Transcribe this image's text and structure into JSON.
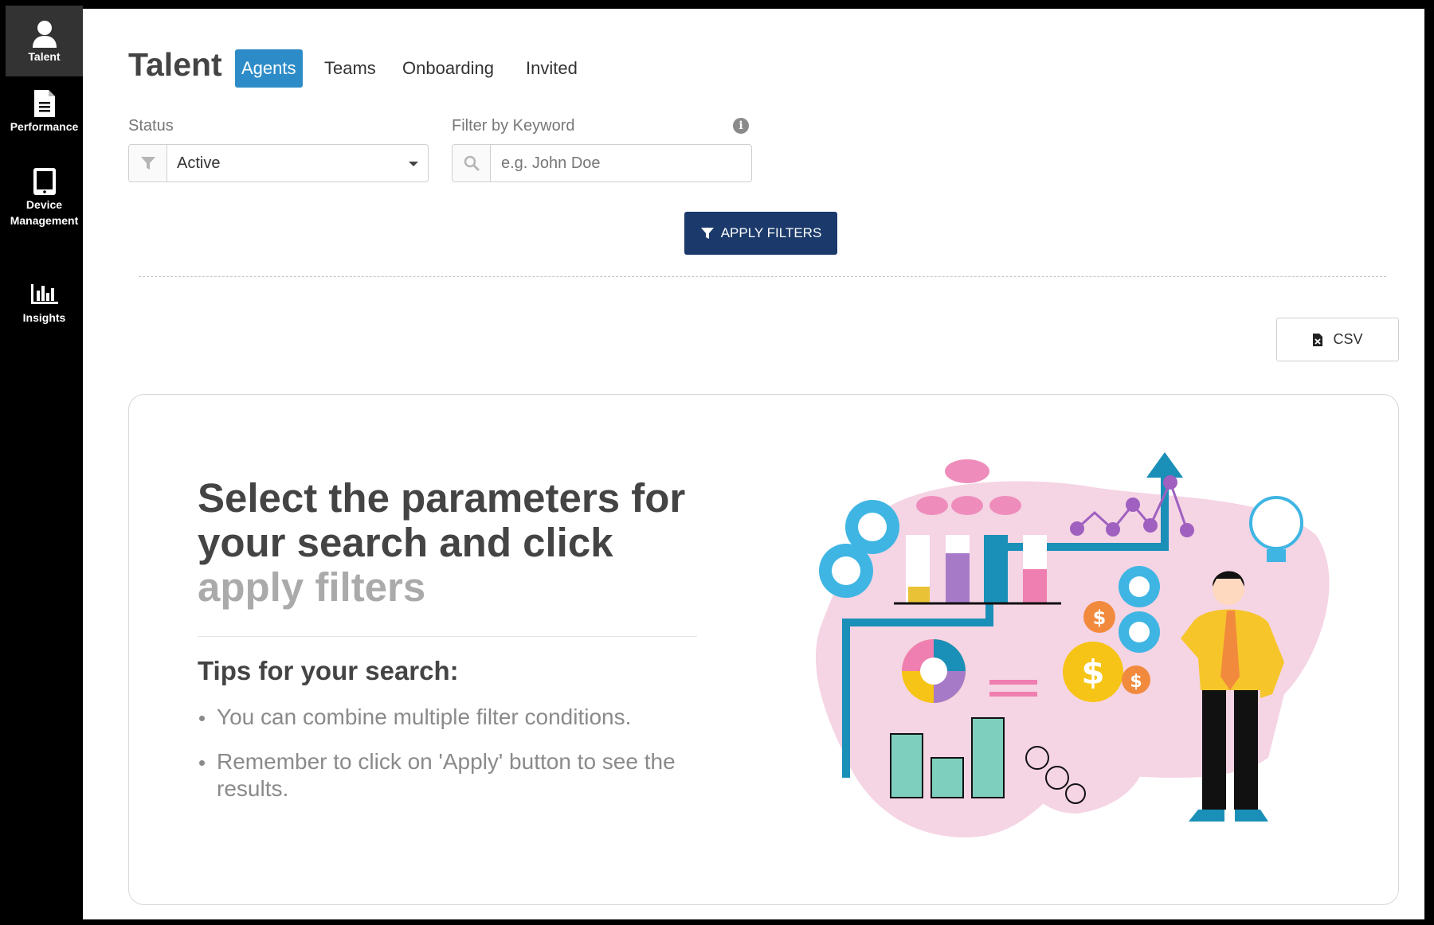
{
  "sidebar": {
    "items": [
      {
        "label": "Talent",
        "icon": "user-icon",
        "active": true
      },
      {
        "label": "Performance",
        "icon": "document-icon",
        "active": false
      },
      {
        "label": "Device Management",
        "icon": "tablet-icon",
        "active": false
      },
      {
        "label": "Insights",
        "icon": "bar-chart-icon",
        "active": false
      }
    ]
  },
  "header": {
    "title": "Talent",
    "tabs": [
      {
        "label": "Agents",
        "active": true
      },
      {
        "label": "Teams",
        "active": false
      },
      {
        "label": "Onboarding",
        "active": false
      },
      {
        "label": "Invited",
        "active": false
      }
    ]
  },
  "filters": {
    "status_label": "Status",
    "status_value": "Active",
    "keyword_label": "Filter by Keyword",
    "keyword_placeholder": "e.g. John Doe",
    "keyword_value": "",
    "apply_label": "APPLY FILTERS"
  },
  "toolbar": {
    "csv_label": "CSV"
  },
  "empty_state": {
    "headline_main": "Select the parameters for your search and click",
    "headline_muted": "apply filters",
    "tips_title": "Tips for your search:",
    "tips": [
      "You can combine multiple filter conditions.",
      "Remember to click on 'Apply' button to see the results."
    ]
  },
  "colors": {
    "accent": "#2d8cc8",
    "apply_button": "#1b3a6b",
    "sidebar_bg": "#000000",
    "sidebar_active": "#333333"
  }
}
